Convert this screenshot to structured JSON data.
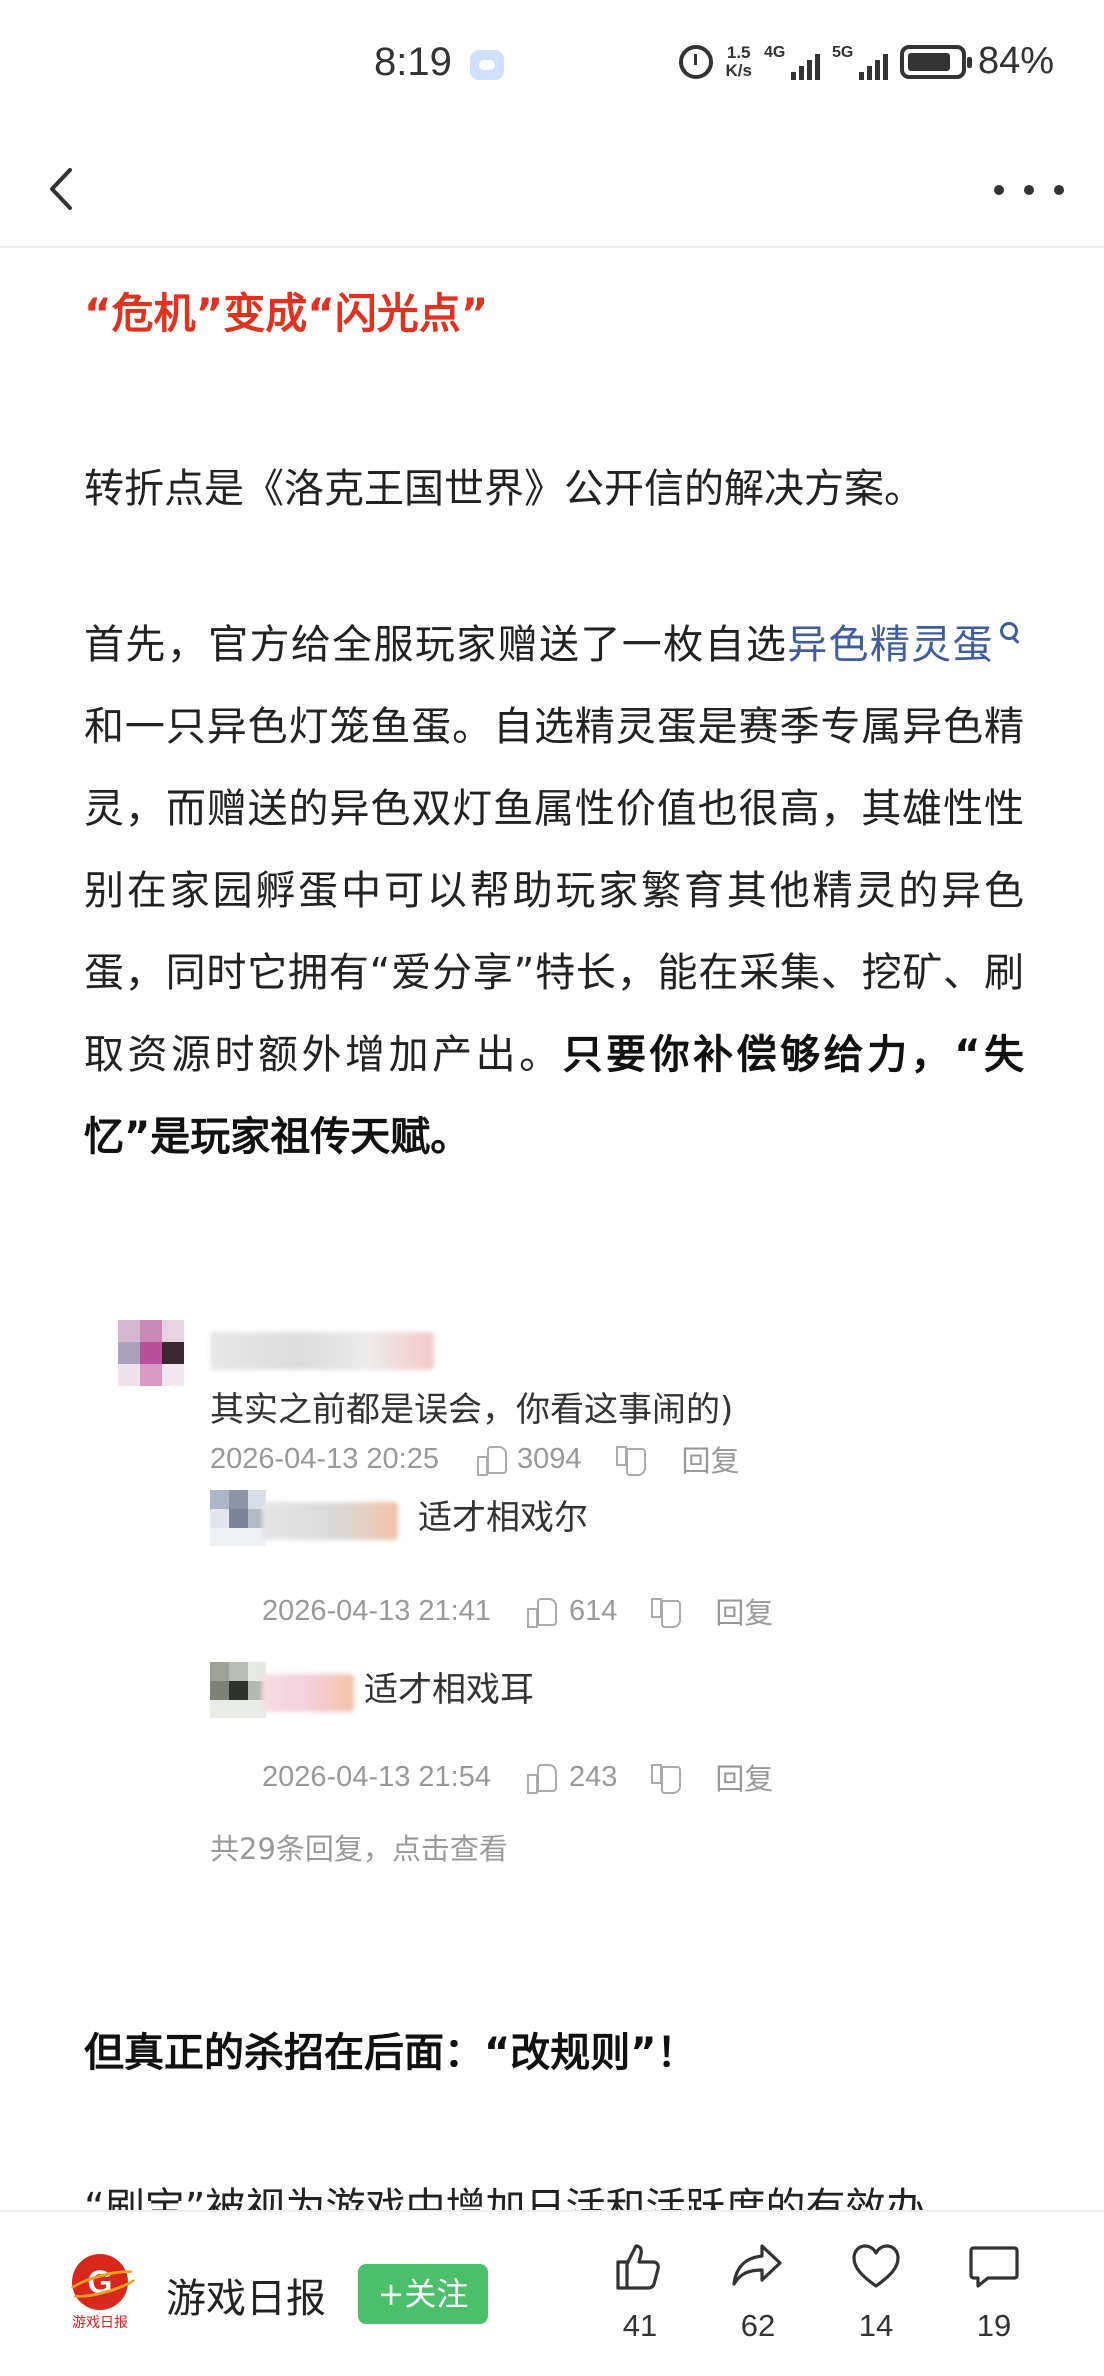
{
  "status_bar": {
    "time": "8:19",
    "net_speed_value": "1.5",
    "net_speed_unit": "K/s",
    "sim1_label": "4G",
    "sim2_label": "5G",
    "battery_level": 0.84,
    "battery_text": "84%"
  },
  "article": {
    "heading": "“危机”变成“闪光点”",
    "para1": "转折点是《洛克王国世界》公开信的解决方案。",
    "para2": {
      "text_a": "首先，官方给全服玩家赠送了一枚自选",
      "link": "异色精灵蛋",
      "text_b": "和一只异色灯笼鱼蛋。自选精灵蛋是赛季专属异色精灵，而赠送的异色双灯鱼属性价值也很高，其雄性性别在家园孵蛋中可以帮助玩家繁育其他精灵的异色蛋，同时它拥有“爱分享”特长，能在采集、挖矿、刷取资源时额外增加产出。",
      "bold": "只要你补偿够给力，“失忆”是玩家祖传天赋。"
    },
    "comments": {
      "main": {
        "text": "其实之前都是误会，你看这事闹的)",
        "time": "2026-04-13 20:25",
        "likes": "3094",
        "reply": "回复"
      },
      "replies": [
        {
          "text": "适才相戏尔",
          "time": "2026-04-13 21:41",
          "likes": "614",
          "reply": "回复"
        },
        {
          "text": "适才相戏耳",
          "time": "2026-04-13 21:54",
          "likes": "243",
          "reply": "回复"
        }
      ],
      "more": "共29条回复，点击查看"
    },
    "subheading": "但真正的杀招在后面：“改规则”！",
    "cut_line": "“刷宝”被视为游戏中增加日活和活跃度的有效办"
  },
  "bottom_bar": {
    "logo_letter": "G",
    "logo_caption": "游戏日报",
    "channel": "游戏日报",
    "follow": "+关注",
    "likes": "41",
    "shares": "62",
    "favorites": "14",
    "comments": "19",
    "follow_color": "#4cbf6a"
  },
  "colors": {
    "heading_red": "#e0321e",
    "link_blue": "#3f5c9e"
  }
}
